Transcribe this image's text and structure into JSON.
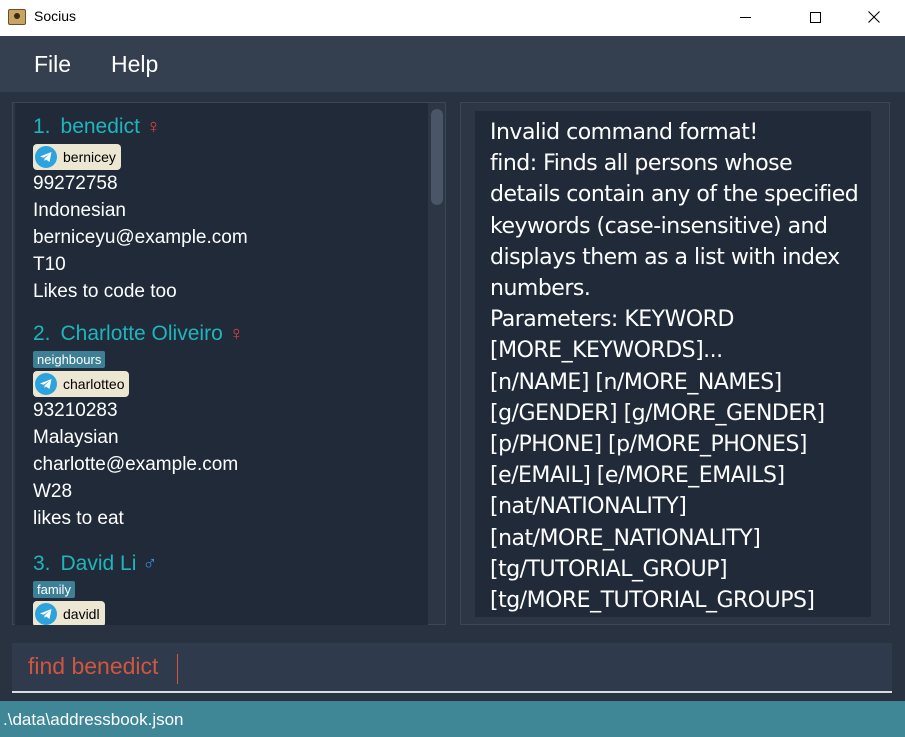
{
  "window": {
    "title": "Socius",
    "minimize_icon": "minimize-icon",
    "maximize_icon": "maximize-icon",
    "close_icon": "close-icon"
  },
  "menu": {
    "file_label": "File",
    "help_label": "Help"
  },
  "persons": [
    {
      "index": "1.",
      "name": "benedict",
      "gender_icon": "female-icon",
      "tags": [],
      "telegram": "bernicey",
      "phone": "99272758",
      "nationality": "Indonesian",
      "email": "berniceyu@example.com",
      "tutorial_group": "T10",
      "remark": "Likes to code too"
    },
    {
      "index": "2.",
      "name": "Charlotte Oliveiro",
      "gender_icon": "female-icon",
      "tags": [
        "neighbours"
      ],
      "telegram": "charlotteo",
      "phone": "93210283",
      "nationality": "Malaysian",
      "email": "charlotte@example.com",
      "tutorial_group": "W28",
      "remark": "likes to eat"
    },
    {
      "index": "3.",
      "name": "David Li",
      "gender_icon": "male-icon",
      "tags": [
        "family"
      ],
      "telegram": "davidl"
    }
  ],
  "result": {
    "text": "Invalid command format!\nfind: Finds all persons whose details contain any of the specified keywords (case-insensitive) and displays them as a list with index numbers.\nParameters: KEYWORD [MORE_KEYWORDS]...\n[n/NAME] [n/MORE_NAMES]\n[g/GENDER] [g/MORE_GENDER]\n[p/PHONE] [p/MORE_PHONES]\n[e/EMAIL] [e/MORE_EMAILS]\n[nat/NATIONALITY]\n[nat/MORE_NATIONALITY]\n[tg/TUTORIAL_GROUP]\n[tg/MORE_TUTORIAL_GROUPS]"
  },
  "command": {
    "value": "find benedict"
  },
  "status": {
    "path": ".\\data\\addressbook.json"
  },
  "colors": {
    "accent": "#1fb5bd",
    "status_bar": "#3f8797",
    "command_text": "#d0563f",
    "female": "#e04040",
    "male": "#3a8ee0",
    "tag": "#3d7f95"
  }
}
